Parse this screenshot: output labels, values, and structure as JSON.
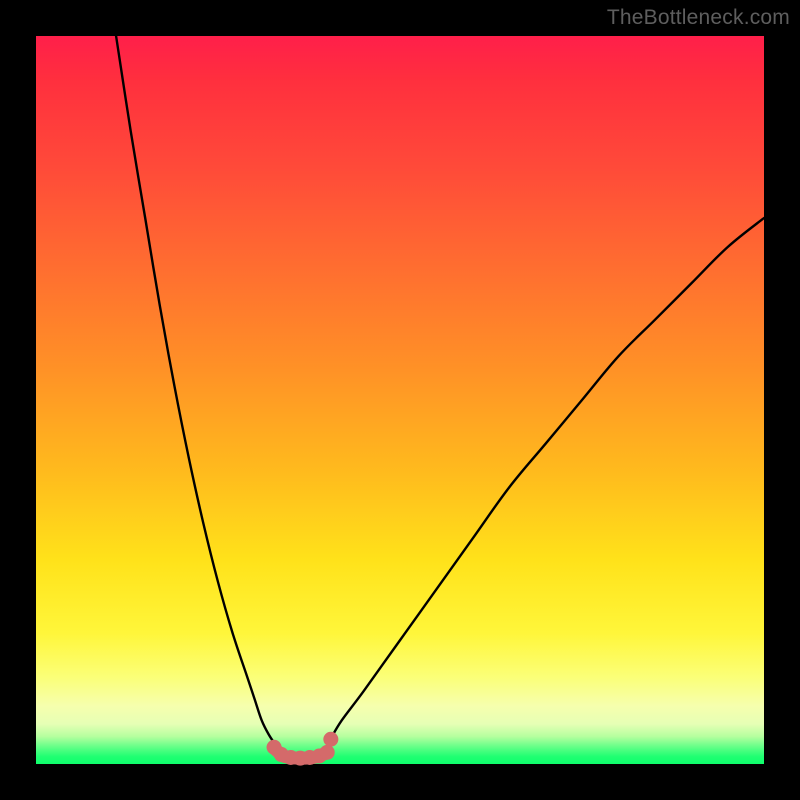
{
  "watermark": "TheBottleneck.com",
  "chart_data": {
    "type": "line",
    "title": "",
    "xlabel": "",
    "ylabel": "",
    "xlim": [
      0,
      100
    ],
    "ylim": [
      0,
      100
    ],
    "grid": false,
    "legend": false,
    "series": [
      {
        "name": "left-curve",
        "color": "#000000",
        "x": [
          11,
          13,
          15,
          17,
          19,
          21,
          23,
          25,
          27,
          29,
          30,
          31,
          32,
          33
        ],
        "values": [
          100,
          87,
          75,
          63,
          52,
          42,
          33,
          25,
          18,
          12,
          9,
          6,
          4,
          2.5
        ]
      },
      {
        "name": "right-curve",
        "color": "#000000",
        "x": [
          40.5,
          42,
          45,
          50,
          55,
          60,
          65,
          70,
          75,
          80,
          85,
          90,
          95,
          100
        ],
        "values": [
          3.5,
          6,
          10,
          17,
          24,
          31,
          38,
          44,
          50,
          56,
          61,
          66,
          71,
          75
        ]
      },
      {
        "name": "trough-markers",
        "color": "#d46a6a",
        "x": [
          32.7,
          33.7,
          35.0,
          36.3,
          37.6,
          38.9,
          40.0,
          40.5
        ],
        "values": [
          2.3,
          1.3,
          0.9,
          0.8,
          0.9,
          1.1,
          1.6,
          3.4
        ]
      }
    ],
    "marker_line": {
      "color": "#d46a6a",
      "x": [
        33.0,
        34.0,
        35.2,
        36.5,
        37.8,
        39.0,
        40.0
      ],
      "values": [
        1.9,
        1.1,
        0.85,
        0.8,
        0.85,
        1.1,
        1.7
      ]
    }
  },
  "colors": {
    "frame": "#000000",
    "curve": "#000000",
    "marker": "#d46a6a",
    "watermark": "#5e5e5e"
  }
}
